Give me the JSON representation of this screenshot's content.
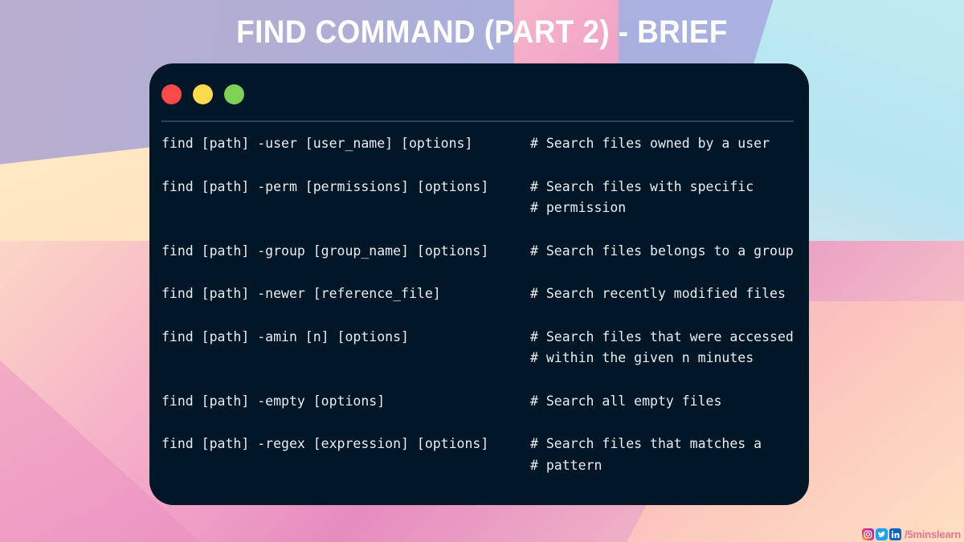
{
  "title": "FIND COMMAND (PART 2) - BRIEF",
  "window": {
    "controls": [
      {
        "name": "close",
        "color": "#fa4a4a"
      },
      {
        "name": "minimize",
        "color": "#fbda4e"
      },
      {
        "name": "maximize",
        "color": "#7fd155"
      }
    ]
  },
  "terminal": {
    "background": "#011627",
    "text_color": "#e9eef2",
    "rows": [
      {
        "command": "find [path] -user [user_name] [options]",
        "comment": [
          "# Search files owned by a user"
        ]
      },
      {
        "command": "find [path] -perm [permissions] [options]",
        "comment": [
          "# Search files with specific",
          "# permission"
        ]
      },
      {
        "command": "find [path] -group [group_name] [options]",
        "comment": [
          "# Search files belongs to a group"
        ]
      },
      {
        "command": "find [path] -newer [reference_file]",
        "comment": [
          "# Search recently modified files"
        ]
      },
      {
        "command": "find [path] -amin [n] [options]",
        "comment": [
          "# Search files that were accessed",
          "# within the given n minutes"
        ]
      },
      {
        "command": "find [path] -empty [options]",
        "comment": [
          "# Search all empty files"
        ]
      },
      {
        "command": "find [path] -regex [expression] [options]",
        "comment": [
          "# Search files that matches a",
          "# pattern"
        ]
      }
    ]
  },
  "footer": {
    "handle": "/5minslearn",
    "social": [
      "instagram-icon",
      "twitter-icon",
      "linkedin-icon"
    ],
    "handle_color": "#e8758f"
  },
  "background": {
    "cream": "#ffe3bd",
    "lavender": "#b0aed4",
    "periwinkle": "#a7aedd",
    "aqua": "#b7e6ef",
    "pink": "#e98bc0",
    "peach": "#ffe0c2"
  }
}
